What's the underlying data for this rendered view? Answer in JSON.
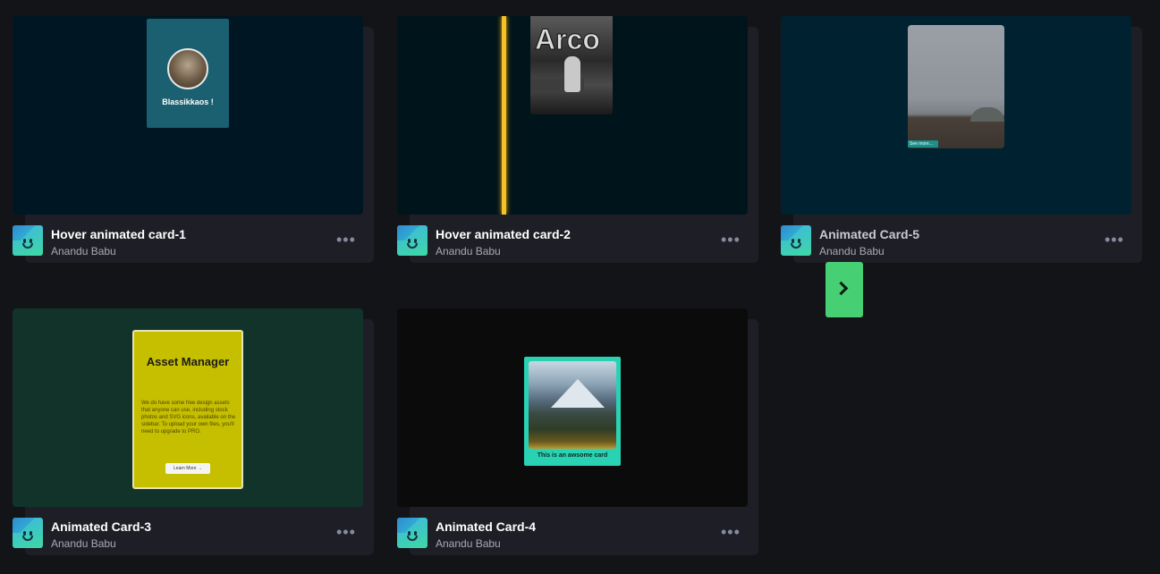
{
  "cards": [
    {
      "title": "Hover animated card-1",
      "author": "Anandu Babu",
      "preview_text": "Blassikkaos !"
    },
    {
      "title": "Hover animated card-2",
      "author": "Anandu Babu",
      "preview_text": "Arco"
    },
    {
      "title": "Animated Card-5",
      "author": "Anandu Babu",
      "preview_text": "See more..."
    },
    {
      "title": "Animated Card-3",
      "author": "Anandu Babu",
      "preview_heading": "Asset Manager",
      "preview_text": "We do have some free design assets that anyone can use, including stock photos and SVG icons, available on the sidebar. To upload your own files, you'll need to upgrade to PRO.",
      "preview_button": "Learn More →"
    },
    {
      "title": "Animated Card-4",
      "author": "Anandu Babu",
      "preview_text": "This is an awsome card"
    }
  ],
  "more_menu_icon": "ellipsis-icon",
  "next_button_icon": "chevron-right-icon",
  "colors": {
    "accent": "#47cf73",
    "background": "#131417",
    "card": "#1e1f26"
  }
}
